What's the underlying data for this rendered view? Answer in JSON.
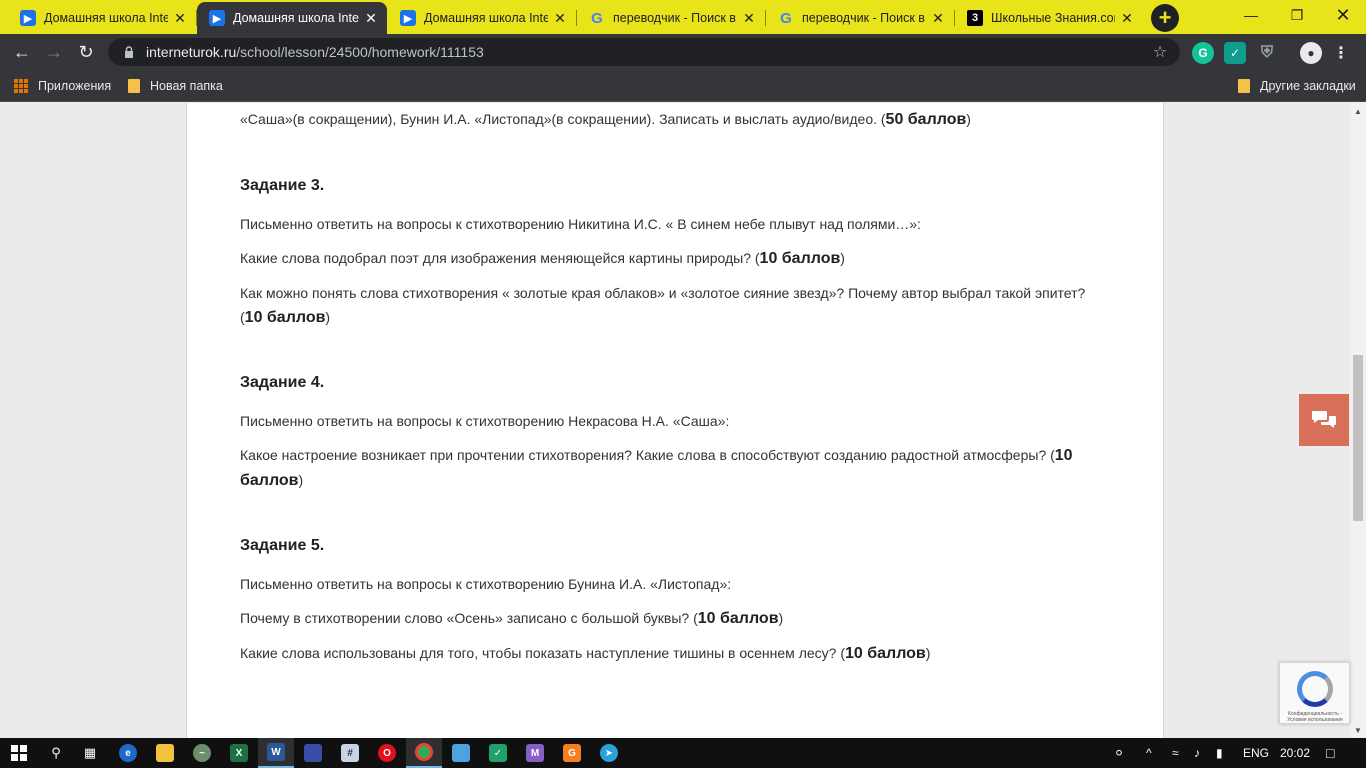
{
  "tabs": [
    {
      "title": "Домашняя школа InternetUrok",
      "icon": "play-icon",
      "active": false
    },
    {
      "title": "Домашняя школа InternetUrok",
      "icon": "play-icon",
      "active": true
    },
    {
      "title": "Домашняя школа InternetUrok",
      "icon": "play-icon",
      "active": false
    },
    {
      "title": "переводчик - Поиск в Google",
      "icon": "google-icon",
      "active": false
    },
    {
      "title": "переводчик - Поиск в Google",
      "icon": "google-icon",
      "active": false
    },
    {
      "title": "Школьные Знания.com",
      "icon": "znanija-icon",
      "active": false
    }
  ],
  "tab_icon_glyphs": {
    "play": "▶",
    "google": "G",
    "znanija": "3"
  },
  "address": {
    "host": "interneturok.ru",
    "path": "/school/lesson/24500/homework/111153"
  },
  "bookmarks": {
    "apps": "Приложения",
    "folder": "Новая папка",
    "other": "Другие закладки"
  },
  "content": {
    "intro_text": "«Саша»(в сокращении), Бунин И.А. «Листопад»(в сокращении). Записать и выслать аудио/видео. (",
    "intro_points": "50 баллов",
    "task3": {
      "heading": "Задание 3.",
      "lead": "Письменно ответить на вопросы к стихотворению Никитина И.С. « В синем небе плывут над полями…»:",
      "q1": "Какие слова подобрал поэт для изображения меняющейся картины природы? (",
      "q1_points": "10 баллов",
      "q2": "Как можно понять слова стихотворения « золотые края облаков» и «золотое сияние звезд»? Почему автор выбрал такой эпитет? (",
      "q2_points": "10 баллов"
    },
    "task4": {
      "heading": "Задание 4.",
      "lead": "Письменно ответить на вопросы к стихотворению Некрасова Н.А. «Саша»:",
      "q1": "Какое настроение возникает при прочтении стихотворения? Какие слова в  способствуют созданию радостной атмосферы? (",
      "q1_points": "10 баллов"
    },
    "task5": {
      "heading": "Задание 5.",
      "lead": "Письменно ответить на вопросы к стихотворению Бунина И.А. «Листопад»:",
      "q1": "Почему в стихотворении слово «Осень» записано с большой буквы? (",
      "q1_points": "10 баллов",
      "q2": "Какие слова использованы для того, чтобы показать наступление тишины в осеннем лесу? (",
      "q2_points": "10 баллов"
    },
    "close_paren": ")"
  },
  "recaptcha_text": "Конфиденциальность - Условия использования",
  "taskbar": {
    "lang": "ENG",
    "time": "20:02",
    "apps": [
      "edge-icon",
      "explorer-icon",
      "excel-icon",
      "word-icon",
      "media-icon",
      "calculator-icon",
      "opera-icon",
      "chrome-icon",
      "app-icon",
      "shield-icon",
      "vs-icon",
      "ext-icon",
      "telegram-icon"
    ]
  }
}
